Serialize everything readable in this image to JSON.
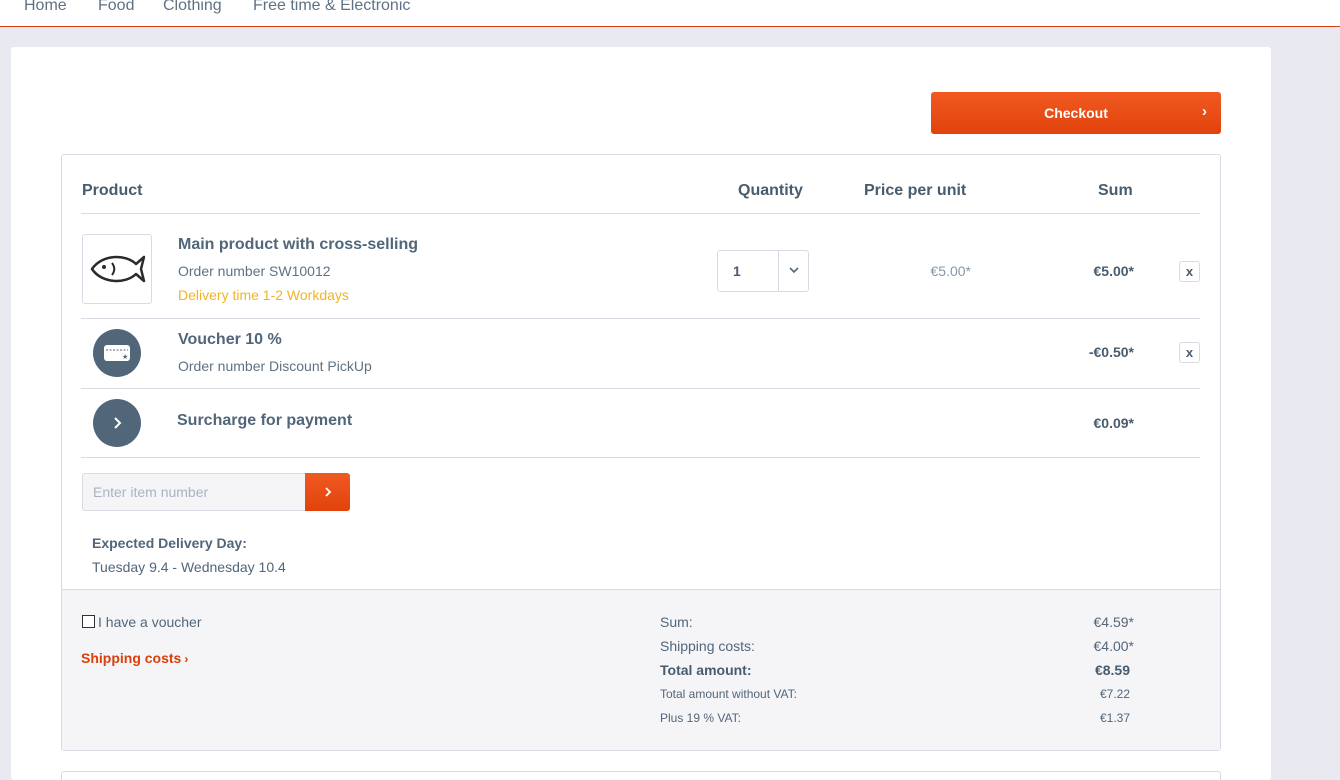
{
  "nav": {
    "items": [
      "Home",
      "Food",
      "Clothing",
      "Free time & Electronic"
    ]
  },
  "checkout": {
    "label": "Checkout",
    "chevron": "›"
  },
  "table": {
    "headers": {
      "product": "Product",
      "quantity": "Quantity",
      "price_per_unit": "Price per unit",
      "sum": "Sum"
    }
  },
  "items": [
    {
      "name": "Main product with cross-selling",
      "order_number": "Order number SW10012",
      "delivery": "Delivery time 1-2 Workdays",
      "quantity": "1",
      "price": "€5.00*",
      "sum": "€5.00*",
      "icon": "fish-icon",
      "remove": "x"
    },
    {
      "name": "Voucher 10 %",
      "order_number": "Order number Discount PickUp",
      "sum": "-€0.50*",
      "icon": "voucher-card-icon",
      "remove": "x"
    },
    {
      "name": "Surcharge for payment",
      "sum": "€0.09*",
      "icon": "chevron-right-icon"
    }
  ],
  "add_item": {
    "placeholder": "Enter item number"
  },
  "expected_delivery": {
    "title": "Expected Delivery Day:",
    "value": "Tuesday 9.4 - Wednesday 10.4"
  },
  "voucher": {
    "label": "I have a voucher",
    "checked": false
  },
  "shipping_link": "Shipping costs",
  "summary": {
    "sum_label": "Sum:",
    "sum_value": "€4.59*",
    "shipping_label": "Shipping costs:",
    "shipping_value": "€4.00*",
    "total_label": "Total amount:",
    "total_value": "€8.59",
    "net_label": "Total amount without VAT:",
    "net_value": "€7.22",
    "vat_label": "Plus 19 % VAT:",
    "vat_value": "€1.37"
  },
  "colors": {
    "accent": "#e2420c",
    "text": "#52667a",
    "delivery": "#f0b429",
    "background": "#e9e9f1"
  }
}
